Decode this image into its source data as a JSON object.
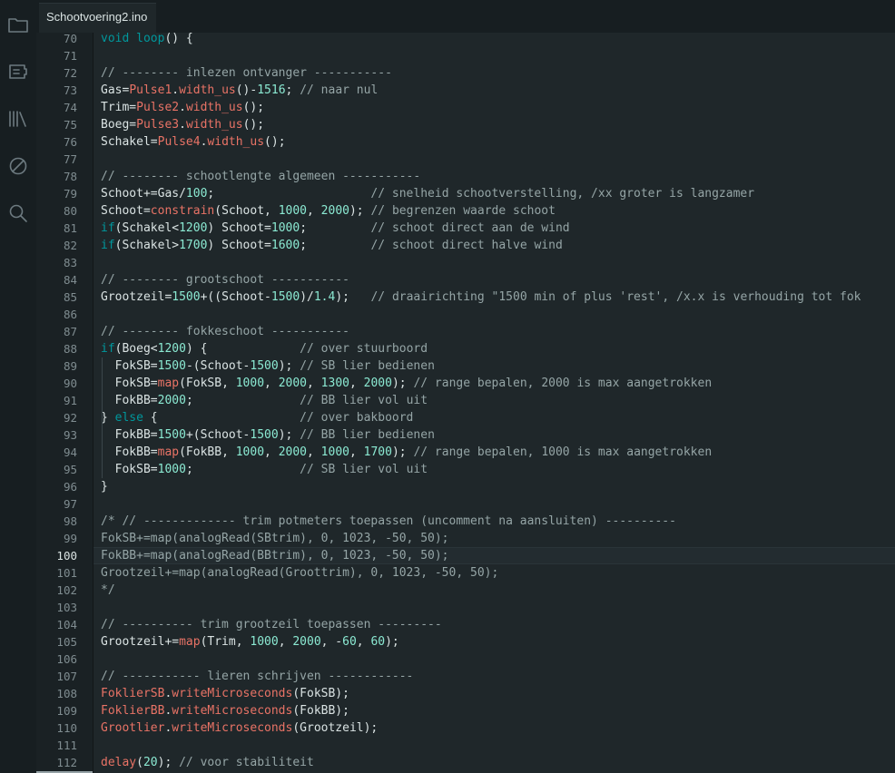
{
  "tab": {
    "filename": "Schootvoering2.ino"
  },
  "activity_icons": [
    "folder-icon",
    "board-icon",
    "library-icon",
    "debug-icon",
    "search-icon"
  ],
  "current_line": 100,
  "colors": {
    "keyword": "#00979c",
    "function": "#e97366",
    "number": "#8be9d2",
    "comment": "#95a5a6",
    "text": "#dae3e3"
  },
  "code": [
    {
      "n": "70",
      "t": [
        [
          "kw",
          "void"
        ],
        [
          "tx",
          " "
        ],
        [
          "kw",
          "loop"
        ],
        [
          "tx",
          "() {"
        ]
      ]
    },
    {
      "n": "71",
      "t": []
    },
    {
      "n": "72",
      "t": [
        [
          "cm",
          "// -------- inlezen ontvanger -----------"
        ]
      ]
    },
    {
      "n": "73",
      "t": [
        [
          "tx",
          "Gas="
        ],
        [
          "fn",
          "Pulse1"
        ],
        [
          "tx",
          "."
        ],
        [
          "fn",
          "width_us"
        ],
        [
          "tx",
          "()-"
        ],
        [
          "num",
          "1516"
        ],
        [
          "tx",
          "; "
        ],
        [
          "cm",
          "// naar nul"
        ]
      ]
    },
    {
      "n": "74",
      "t": [
        [
          "tx",
          "Trim="
        ],
        [
          "fn",
          "Pulse2"
        ],
        [
          "tx",
          "."
        ],
        [
          "fn",
          "width_us"
        ],
        [
          "tx",
          "();"
        ]
      ]
    },
    {
      "n": "75",
      "t": [
        [
          "tx",
          "Boeg="
        ],
        [
          "fn",
          "Pulse3"
        ],
        [
          "tx",
          "."
        ],
        [
          "fn",
          "width_us"
        ],
        [
          "tx",
          "();"
        ]
      ]
    },
    {
      "n": "76",
      "t": [
        [
          "tx",
          "Schakel="
        ],
        [
          "fn",
          "Pulse4"
        ],
        [
          "tx",
          "."
        ],
        [
          "fn",
          "width_us"
        ],
        [
          "tx",
          "();"
        ]
      ]
    },
    {
      "n": "77",
      "t": []
    },
    {
      "n": "78",
      "t": [
        [
          "cm",
          "// -------- schootlengte algemeen -----------"
        ]
      ]
    },
    {
      "n": "79",
      "t": [
        [
          "tx",
          "Schoot+=Gas/"
        ],
        [
          "num",
          "100"
        ],
        [
          "tx",
          ";                      "
        ],
        [
          "cm",
          "// snelheid schootverstelling, /xx groter is langzamer"
        ]
      ]
    },
    {
      "n": "80",
      "t": [
        [
          "tx",
          "Schoot="
        ],
        [
          "fn",
          "constrain"
        ],
        [
          "tx",
          "(Schoot, "
        ],
        [
          "num",
          "1000"
        ],
        [
          "tx",
          ", "
        ],
        [
          "num",
          "2000"
        ],
        [
          "tx",
          "); "
        ],
        [
          "cm",
          "// begrenzen waarde schoot"
        ]
      ]
    },
    {
      "n": "81",
      "t": [
        [
          "kw",
          "if"
        ],
        [
          "tx",
          "(Schakel<"
        ],
        [
          "num",
          "1200"
        ],
        [
          "tx",
          ") Schoot="
        ],
        [
          "num",
          "1000"
        ],
        [
          "tx",
          ";         "
        ],
        [
          "cm",
          "// schoot direct aan de wind"
        ]
      ]
    },
    {
      "n": "82",
      "t": [
        [
          "kw",
          "if"
        ],
        [
          "tx",
          "(Schakel>"
        ],
        [
          "num",
          "1700"
        ],
        [
          "tx",
          ") Schoot="
        ],
        [
          "num",
          "1600"
        ],
        [
          "tx",
          ";         "
        ],
        [
          "cm",
          "// schoot direct halve wind"
        ]
      ]
    },
    {
      "n": "83",
      "t": []
    },
    {
      "n": "84",
      "t": [
        [
          "cm",
          "// -------- grootschoot -----------"
        ]
      ]
    },
    {
      "n": "85",
      "t": [
        [
          "tx",
          "Grootzeil="
        ],
        [
          "num",
          "1500"
        ],
        [
          "tx",
          "+((Schoot-"
        ],
        [
          "num",
          "1500"
        ],
        [
          "tx",
          ")/"
        ],
        [
          "num",
          "1.4"
        ],
        [
          "tx",
          ");   "
        ],
        [
          "cm",
          "// draairichting \"1500 min of plus 'rest', /x.x is verhouding tot fok"
        ]
      ]
    },
    {
      "n": "86",
      "t": []
    },
    {
      "n": "87",
      "t": [
        [
          "cm",
          "// -------- fokkeschoot -----------"
        ]
      ]
    },
    {
      "n": "88",
      "t": [
        [
          "kw",
          "if"
        ],
        [
          "tx",
          "(Boeg<"
        ],
        [
          "num",
          "1200"
        ],
        [
          "tx",
          ") {             "
        ],
        [
          "cm",
          "// over stuurboord"
        ]
      ]
    },
    {
      "n": "89",
      "t": [
        [
          "tx",
          "  FokSB="
        ],
        [
          "num",
          "1500"
        ],
        [
          "tx",
          "-(Schoot-"
        ],
        [
          "num",
          "1500"
        ],
        [
          "tx",
          "); "
        ],
        [
          "cm",
          "// SB lier bedienen"
        ]
      ]
    },
    {
      "n": "90",
      "t": [
        [
          "tx",
          "  FokSB="
        ],
        [
          "fn",
          "map"
        ],
        [
          "tx",
          "(FokSB, "
        ],
        [
          "num",
          "1000"
        ],
        [
          "tx",
          ", "
        ],
        [
          "num",
          "2000"
        ],
        [
          "tx",
          ", "
        ],
        [
          "num",
          "1300"
        ],
        [
          "tx",
          ", "
        ],
        [
          "num",
          "2000"
        ],
        [
          "tx",
          "); "
        ],
        [
          "cm",
          "// range bepalen, 2000 is max aangetrokken"
        ]
      ]
    },
    {
      "n": "91",
      "t": [
        [
          "tx",
          "  FokBB="
        ],
        [
          "num",
          "2000"
        ],
        [
          "tx",
          ";               "
        ],
        [
          "cm",
          "// BB lier vol uit"
        ]
      ]
    },
    {
      "n": "92",
      "t": [
        [
          "tx",
          "} "
        ],
        [
          "kw",
          "else"
        ],
        [
          "tx",
          " {                    "
        ],
        [
          "cm",
          "// over bakboord"
        ]
      ]
    },
    {
      "n": "93",
      "t": [
        [
          "tx",
          "  FokBB="
        ],
        [
          "num",
          "1500"
        ],
        [
          "tx",
          "+(Schoot-"
        ],
        [
          "num",
          "1500"
        ],
        [
          "tx",
          "); "
        ],
        [
          "cm",
          "// BB lier bedienen"
        ]
      ]
    },
    {
      "n": "94",
      "t": [
        [
          "tx",
          "  FokBB="
        ],
        [
          "fn",
          "map"
        ],
        [
          "tx",
          "(FokBB, "
        ],
        [
          "num",
          "1000"
        ],
        [
          "tx",
          ", "
        ],
        [
          "num",
          "2000"
        ],
        [
          "tx",
          ", "
        ],
        [
          "num",
          "1000"
        ],
        [
          "tx",
          ", "
        ],
        [
          "num",
          "1700"
        ],
        [
          "tx",
          "); "
        ],
        [
          "cm",
          "// range bepalen, 1000 is max aangetrokken"
        ]
      ]
    },
    {
      "n": "95",
      "t": [
        [
          "tx",
          "  FokSB="
        ],
        [
          "num",
          "1000"
        ],
        [
          "tx",
          ";               "
        ],
        [
          "cm",
          "// SB lier vol uit"
        ]
      ]
    },
    {
      "n": "96",
      "t": [
        [
          "tx",
          "}"
        ]
      ]
    },
    {
      "n": "97",
      "t": []
    },
    {
      "n": "98",
      "t": [
        [
          "cm",
          "/* // ------------- trim potmeters toepassen (uncomment na aansluiten) ----------"
        ]
      ]
    },
    {
      "n": "99",
      "t": [
        [
          "cm",
          "FokSB+=map(analogRead(SBtrim), 0, 1023, -50, 50);"
        ]
      ]
    },
    {
      "n": "100",
      "t": [
        [
          "cm",
          "FokBB+=map(analogRead(BBtrim), 0, 1023, -50, 50);"
        ]
      ]
    },
    {
      "n": "101",
      "t": [
        [
          "cm",
          "Grootzeil+=map(analogRead(Groottrim), 0, 1023, -50, 50);"
        ]
      ]
    },
    {
      "n": "102",
      "t": [
        [
          "cm",
          "*/"
        ]
      ]
    },
    {
      "n": "103",
      "t": []
    },
    {
      "n": "104",
      "t": [
        [
          "cm",
          "// ---------- trim grootzeil toepassen ---------"
        ]
      ]
    },
    {
      "n": "105",
      "t": [
        [
          "tx",
          "Grootzeil+="
        ],
        [
          "fn",
          "map"
        ],
        [
          "tx",
          "(Trim, "
        ],
        [
          "num",
          "1000"
        ],
        [
          "tx",
          ", "
        ],
        [
          "num",
          "2000"
        ],
        [
          "tx",
          ", -"
        ],
        [
          "num",
          "60"
        ],
        [
          "tx",
          ", "
        ],
        [
          "num",
          "60"
        ],
        [
          "tx",
          ");"
        ]
      ]
    },
    {
      "n": "106",
      "t": []
    },
    {
      "n": "107",
      "t": [
        [
          "cm",
          "// ----------- lieren schrijven ------------"
        ]
      ]
    },
    {
      "n": "108",
      "t": [
        [
          "fn",
          "FoklierSB"
        ],
        [
          "tx",
          "."
        ],
        [
          "fn",
          "writeMicroseconds"
        ],
        [
          "tx",
          "(FokSB);"
        ]
      ]
    },
    {
      "n": "109",
      "t": [
        [
          "fn",
          "FoklierBB"
        ],
        [
          "tx",
          "."
        ],
        [
          "fn",
          "writeMicroseconds"
        ],
        [
          "tx",
          "(FokBB);"
        ]
      ]
    },
    {
      "n": "110",
      "t": [
        [
          "fn",
          "Grootlier"
        ],
        [
          "tx",
          "."
        ],
        [
          "fn",
          "writeMicroseconds"
        ],
        [
          "tx",
          "(Grootzeil);"
        ]
      ]
    },
    {
      "n": "111",
      "t": []
    },
    {
      "n": "112",
      "t": [
        [
          "fn",
          "delay"
        ],
        [
          "tx",
          "("
        ],
        [
          "num",
          "20"
        ],
        [
          "tx",
          "); "
        ],
        [
          "cm",
          "// voor stabiliteit"
        ]
      ]
    }
  ]
}
